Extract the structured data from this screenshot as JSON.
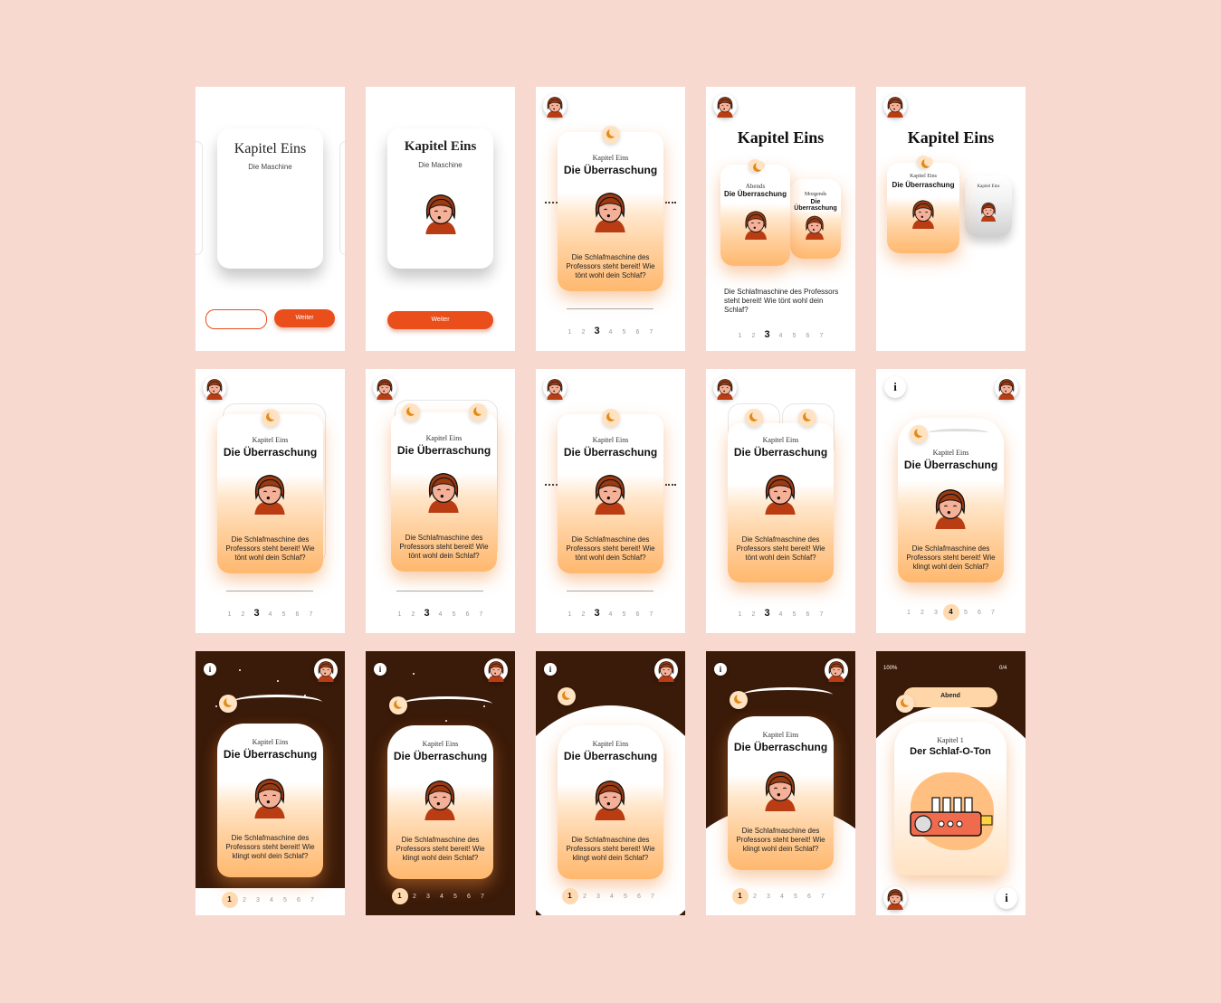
{
  "chapter_title": "Kapitel Eins",
  "chapter_subtitle": "Die Maschine",
  "card_kicker": "Kapitel Eins",
  "card_title": "Die Überraschung",
  "card_desc_a": "Die Schlafmaschine des Professors steht bereit! Wie tönt wohl dein Schlaf?",
  "card_desc_b": "Die Schlafmaschine des Professors steht bereit! Wie klingt wohl dein Schlaf?",
  "buttons": {
    "next": "Weiter",
    "back": ""
  },
  "carousel": {
    "evening": "Abends",
    "morning": "Morgends",
    "evening_title": "Die Überraschung",
    "morning_title": "Die Überraschung",
    "dots": "..."
  },
  "pager": [
    "1",
    "2",
    "3",
    "4",
    "5",
    "6",
    "7"
  ],
  "info_label": "i",
  "final": {
    "battery": "100%",
    "progress": "0/4",
    "slider_label": "Abend",
    "kicker": "Kapitel 1",
    "title": "Der Schlaf-O-Ton"
  },
  "colors": {
    "bg": "#f7d9d0",
    "accent": "#e94e1b",
    "dark": "#3a1a08",
    "peach": "#ffb86e"
  },
  "icons": [
    "moon-icon",
    "avatar-icon",
    "info-icon",
    "radio-icon",
    "battery-icon",
    "timer-icon"
  ]
}
